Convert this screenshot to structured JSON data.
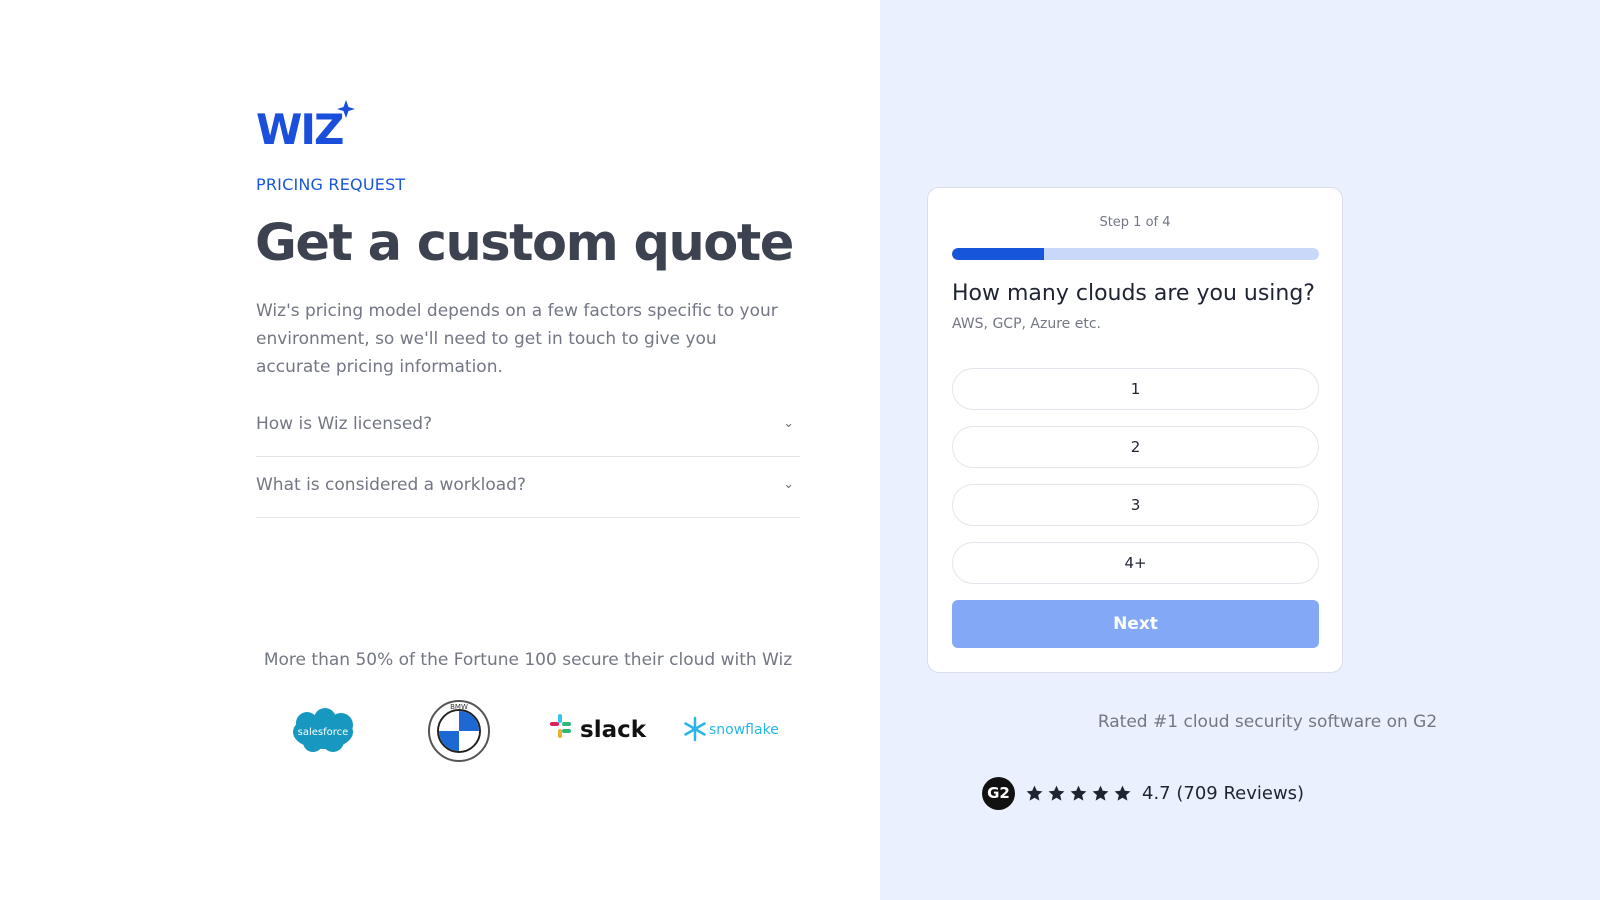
{
  "brand": {
    "logo_text": "WIZ"
  },
  "header": {
    "eyebrow": "PRICING REQUEST",
    "headline": "Get a custom quote",
    "intro": "Wiz's pricing model depends on a few factors specific to your environment, so we'll need to get in touch to give you accurate pricing information."
  },
  "faq": [
    {
      "question": "How is Wiz licensed?"
    },
    {
      "question": "What is considered a workload?"
    }
  ],
  "social_proof": {
    "text": "More than 50% of the Fortune 100 secure their cloud with Wiz",
    "logos": [
      "salesforce",
      "BMW",
      "slack",
      "snowflake"
    ]
  },
  "form": {
    "step": "Step 1 of 4",
    "progress": 0.25,
    "question": "How many clouds are you using?",
    "hint": "AWS, GCP, Azure etc.",
    "options": [
      "1",
      "2",
      "3",
      "4+"
    ],
    "next_label": "Next"
  },
  "rating": {
    "headline": "Rated #1 cloud security software on G2",
    "badge": "G2",
    "stars": 5,
    "score_text": "4.7 (709 Reviews)"
  },
  "colors": {
    "accent": "#1756db",
    "panel_bg": "#eaf0fe",
    "next_button": "#82a8f6"
  }
}
